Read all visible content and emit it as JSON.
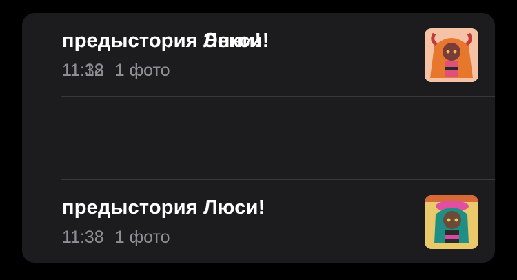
{
  "notes": [
    {
      "title": "предыстория Энни!",
      "time": "11:38",
      "attachments": "1 фото",
      "thumbnail_icon": "character-thumbnail-icon",
      "thumb_colors": {
        "bg": "#7cc6a4",
        "hair": "#7b3fd6",
        "hat": "#6aa9e8",
        "skin": "#f4d6c6"
      }
    },
    {
      "title": "предыстория Люси!",
      "time": "11:38",
      "attachments": "1 фото",
      "thumbnail_icon": "character-thumbnail-icon",
      "thumb_colors": {
        "bg": "#e9c96a",
        "hair": "#1f8f86",
        "hat": "#e04fa0",
        "skin": "#6b4a3a"
      }
    },
    {
      "title": "предыстория Лекси!",
      "time": "11:12",
      "attachments": "1 фото",
      "thumbnail_icon": "character-thumbnail-icon",
      "thumb_colors": {
        "bg": "#f5c2a6",
        "hair": "#e8772e",
        "hat": "#c23a3a",
        "skin": "#7a3c3a"
      }
    }
  ],
  "colors": {
    "background": "#000000",
    "card": "#1c1c1e",
    "title": "#ffffff",
    "meta": "#8e8e93",
    "divider": "#38383a"
  }
}
